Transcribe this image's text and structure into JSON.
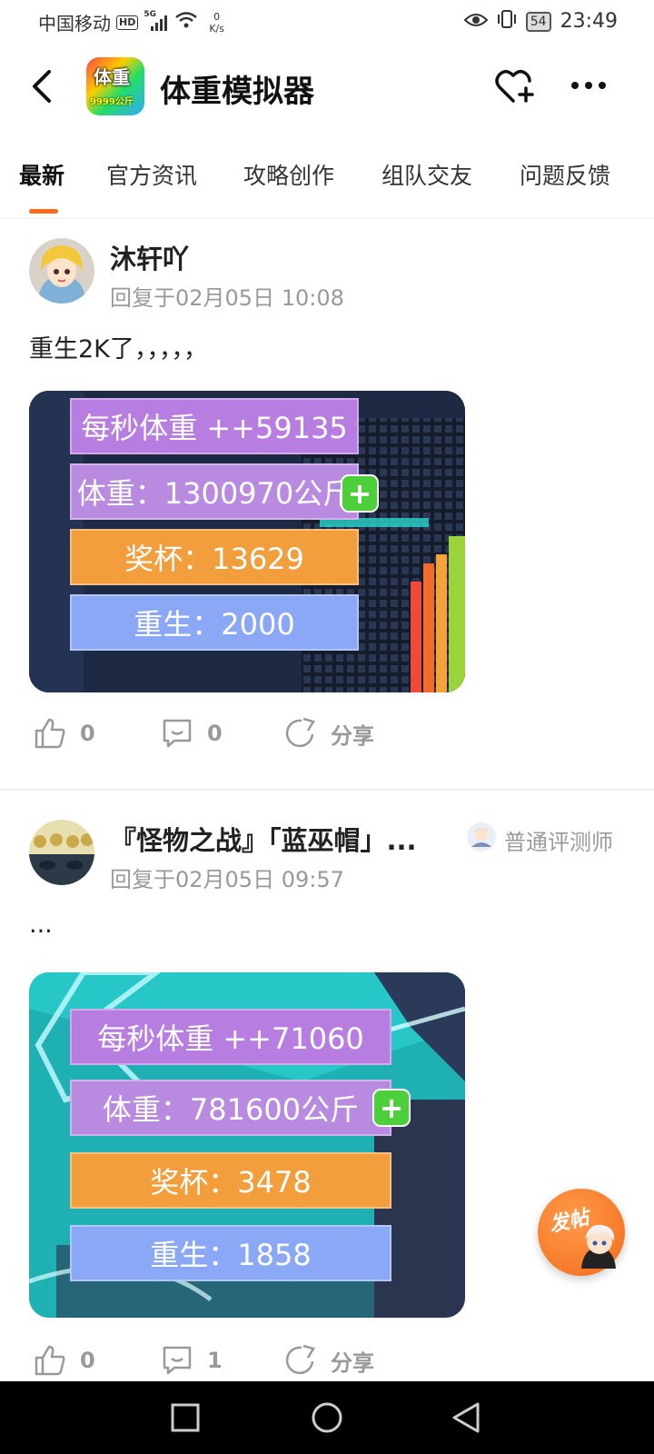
{
  "status_bar": {
    "carrier": "中国移动",
    "hd": "HD",
    "network": "5G",
    "speed_value": "0",
    "speed_unit": "K/s",
    "battery": "54",
    "time": "23:49"
  },
  "header": {
    "app_title": "体重模拟器",
    "icon_text_top": "体重",
    "icon_text_bottom": "9999公斤"
  },
  "tabs": [
    {
      "label": "最新",
      "active": true
    },
    {
      "label": "官方资讯",
      "active": false
    },
    {
      "label": "攻略创作",
      "active": false
    },
    {
      "label": "组队交友",
      "active": false
    },
    {
      "label": "问题反馈",
      "active": false
    }
  ],
  "posts": [
    {
      "username": "沐轩吖",
      "meta": "回复于02月05日 10:08",
      "content": "重生2K了，，，，，",
      "image_stats": {
        "per_second": "每秒体重 ++59135",
        "weight": "体重：1300970公斤",
        "trophy": "奖杯：13629",
        "rebirth": "重生：2000"
      },
      "likes": "0",
      "comments": "0",
      "share": "分享"
    },
    {
      "username": "『怪物之战』「蓝巫帽」...",
      "badge": "普通评测师",
      "meta": "回复于02月05日 09:57",
      "content": "...",
      "image_stats": {
        "per_second": "每秒体重 ++71060",
        "weight": "体重：781600公斤",
        "trophy": "奖杯：3478",
        "rebirth": "重生：1858"
      },
      "likes": "0",
      "comments": "1",
      "share": "分享"
    }
  ],
  "fab": {
    "label": "发帖"
  },
  "colors": {
    "accent": "#ff6a1a",
    "meta_gray": "#999999"
  }
}
